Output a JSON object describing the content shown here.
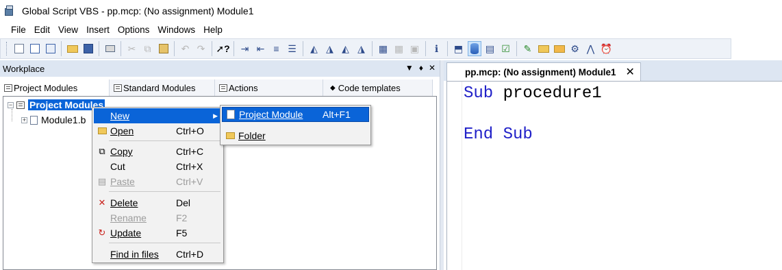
{
  "window": {
    "title": "Global Script VBS - pp.mcp: (No assignment) Module1"
  },
  "menubar": [
    "File",
    "Edit",
    "View",
    "Insert",
    "Options",
    "Windows",
    "Help"
  ],
  "toolbar": {
    "groups": [
      [
        "new-document-icon",
        "new-module-icon",
        "new-project-icon"
      ],
      [
        "open-folder-icon",
        "save-icon"
      ],
      [
        "print-icon"
      ],
      [
        "cut-icon",
        "copy-icon",
        "paste-icon"
      ],
      [
        "undo-icon",
        "redo-icon"
      ],
      [
        "whats-this-icon"
      ],
      [
        "indent-icon",
        "outdent-icon",
        "align-icon",
        "comment-icon"
      ],
      [
        "bookmark-icon",
        "bookmark-next-icon",
        "bookmark-prev-icon",
        "bookmark-clear-icon"
      ],
      [
        "compile-icon",
        "compile-all-icon",
        "debug-icon"
      ],
      [
        "info-icon"
      ],
      [
        "back-icon",
        "database-icon",
        "tags-icon",
        "check-icon"
      ],
      [
        "edit-icon",
        "folder-icon",
        "add-folder-icon",
        "triggers-icon",
        "compass-icon",
        "clock-icon"
      ]
    ]
  },
  "workplace": {
    "title": "Workplace",
    "controls": [
      "▼",
      "♦",
      "✕"
    ],
    "tabs": [
      "Project Modules",
      "Standard Modules",
      "Actions",
      "Code templates"
    ],
    "tree": {
      "root": "Project Modules",
      "child": "Module1.b"
    }
  },
  "editor": {
    "tab_title": "pp.mcp: (No assignment) Module1",
    "tab_close": "✕",
    "code": [
      {
        "kw": "Sub",
        "rest": " procedure1"
      },
      {
        "kw": "",
        "rest": ""
      },
      {
        "kw": "End Sub",
        "rest": ""
      }
    ]
  },
  "context_menu": {
    "items": [
      {
        "label": "New",
        "shortcut": "",
        "state": "highlighted",
        "submenu": true,
        "icon": ""
      },
      {
        "label": "Open",
        "shortcut": "Ctrl+O",
        "state": "enabled",
        "icon": "open-folder-icon"
      },
      {
        "label": "Copy",
        "shortcut": "Ctrl+C",
        "state": "enabled",
        "icon": "copy-icon"
      },
      {
        "label": "Cut",
        "shortcut": "Ctrl+X",
        "state": "enabled",
        "icon": ""
      },
      {
        "label": "Paste",
        "shortcut": "Ctrl+V",
        "state": "disabled",
        "icon": "paste-icon"
      },
      {
        "label": "Delete",
        "shortcut": "Del",
        "state": "enabled",
        "icon": "delete-icon"
      },
      {
        "label": "Rename",
        "shortcut": "F2",
        "state": "disabled",
        "icon": ""
      },
      {
        "label": "Update",
        "shortcut": "F5",
        "state": "enabled",
        "icon": "update-icon"
      },
      {
        "label": "Find in files",
        "shortcut": "Ctrl+D",
        "state": "enabled",
        "icon": ""
      }
    ],
    "submenu": [
      {
        "label": "Project Module",
        "shortcut": "Alt+F1",
        "state": "highlighted",
        "icon": "project-module-icon"
      },
      {
        "label": "Folder",
        "shortcut": "",
        "state": "enabled",
        "icon": "folder-icon"
      }
    ]
  },
  "colors": {
    "selection": "#0a64d8",
    "keyword": "#2020c8",
    "toolbar_bg": "#eef2f8"
  }
}
